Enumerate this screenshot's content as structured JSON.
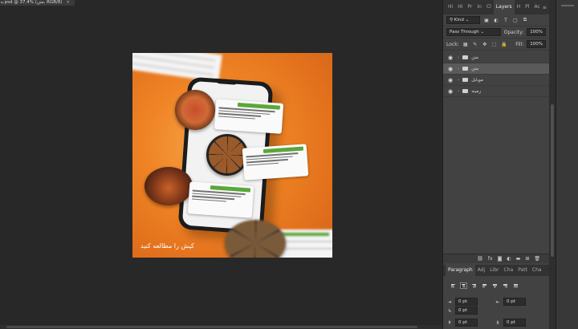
{
  "document": {
    "tab_label": "ه.psd @ 37.4% (متن, RGB/8)",
    "close_glyph": "×"
  },
  "artboard": {
    "cta_text": "کیش را مطالعه کنید"
  },
  "panels": {
    "top_tabs": [
      "Hi",
      "Hi",
      "Pr",
      "In",
      "Cl",
      "Layers",
      "H",
      "Pl",
      "Ac"
    ],
    "active_tab": "Layers",
    "filter_kind": "Kind",
    "blend_mode": "Pass Through",
    "opacity_label": "Opacity:",
    "opacity_value": "100%",
    "lock_label": "Lock:",
    "fill_label": "Fill:",
    "fill_value": "100%",
    "layers": [
      {
        "name": "متن",
        "selected": false
      },
      {
        "name": "متن",
        "selected": true
      },
      {
        "name": "موبایل",
        "selected": false
      },
      {
        "name": "زمینه",
        "selected": false
      }
    ],
    "layer_tool_icons": [
      "link-icon",
      "fx-icon",
      "mask-icon",
      "adjustment-icon",
      "group-icon",
      "new-layer-icon",
      "trash-icon"
    ],
    "paragraph_tabs": [
      "Paragraph",
      "Adj",
      "Libr",
      "Cha",
      "Patt",
      "Cha"
    ],
    "active_paragraph_tab": "Paragraph",
    "indents": {
      "left": "0 pt",
      "right": "0 pt",
      "first": "0 pt",
      "before": "0 pt",
      "after": "0 pt"
    }
  }
}
